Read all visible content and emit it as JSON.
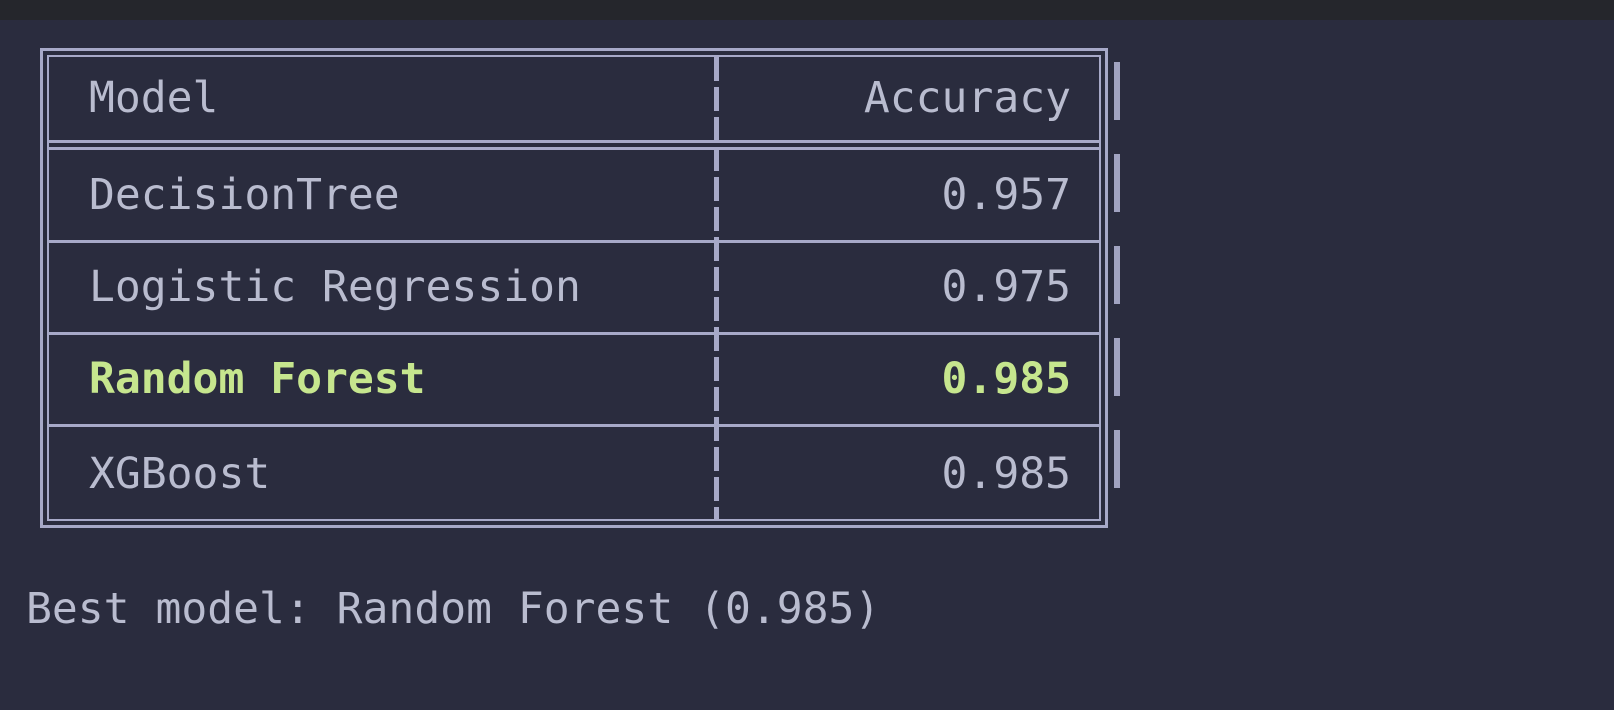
{
  "table": {
    "header": {
      "model": "Model",
      "accuracy": "Accuracy"
    },
    "rows": [
      {
        "model": "DecisionTree",
        "accuracy": "0.957",
        "highlight": false
      },
      {
        "model": "Logistic Regression",
        "accuracy": "0.975",
        "highlight": false
      },
      {
        "model": "Random Forest",
        "accuracy": "0.985",
        "highlight": true
      },
      {
        "model": "XGBoost",
        "accuracy": "0.985",
        "highlight": false
      }
    ]
  },
  "footer": {
    "text": "Best model: Random Forest (0.985)"
  },
  "colors": {
    "background": "#2a2c3e",
    "top_bar": "#25262c",
    "text": "#b9bccf",
    "border": "#a7a9c8",
    "highlight": "#c6e68e"
  }
}
